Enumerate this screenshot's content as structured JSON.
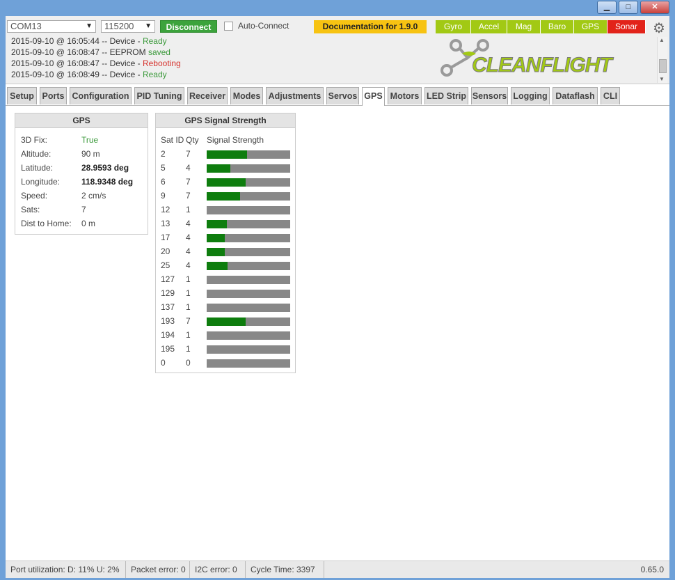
{
  "window": {
    "minimize": "▁",
    "maximize": "□",
    "close": "✕"
  },
  "connection": {
    "port": "COM13",
    "baud": "115200",
    "disconnect_label": "Disconnect",
    "auto_connect_label": "Auto-Connect"
  },
  "documentation_label": "Documentation for 1.9.0",
  "sensors": [
    {
      "label": "Gyro",
      "state": "on"
    },
    {
      "label": "Accel",
      "state": "on"
    },
    {
      "label": "Mag",
      "state": "on"
    },
    {
      "label": "Baro",
      "state": "on"
    },
    {
      "label": "GPS",
      "state": "on"
    },
    {
      "label": "Sonar",
      "state": "off"
    }
  ],
  "log": [
    {
      "prefix": "2015-09-10 @ 16:05:44 -- Device - ",
      "status": "Ready",
      "kind": "ok"
    },
    {
      "prefix": "2015-09-10 @ 16:08:47 -- EEPROM ",
      "status": "saved",
      "kind": "ok"
    },
    {
      "prefix": "2015-09-10 @ 16:08:47 -- Device - ",
      "status": "Rebooting",
      "kind": "warn"
    },
    {
      "prefix": "2015-09-10 @ 16:08:49 -- Device - ",
      "status": "Ready",
      "kind": "ok"
    }
  ],
  "logo_text": "CLEANFLIGHT",
  "tabs": [
    "Setup",
    "Ports",
    "Configuration",
    "PID Tuning",
    "Receiver",
    "Modes",
    "Adjustments",
    "Servos",
    "GPS",
    "Motors",
    "LED Strip",
    "Sensors",
    "Logging",
    "Dataflash",
    "CLI"
  ],
  "active_tab": "GPS",
  "gps_panel": {
    "title": "GPS",
    "rows": [
      {
        "label": "3D Fix:",
        "value": "True",
        "style": "green"
      },
      {
        "label": "Altitude:",
        "value": "90 m",
        "style": ""
      },
      {
        "label": "Latitude:",
        "value": "28.9593 deg",
        "style": "bold"
      },
      {
        "label": "Longitude:",
        "value": "118.9348 deg",
        "style": "bold"
      },
      {
        "label": "Speed:",
        "value": "2 cm/s",
        "style": ""
      },
      {
        "label": "Sats:",
        "value": "7",
        "style": ""
      },
      {
        "label": "Dist to Home:",
        "value": "0 m",
        "style": ""
      }
    ]
  },
  "signal_panel": {
    "title": "GPS Signal Strength",
    "headers": {
      "sat_id": "Sat ID",
      "qty": "Qty",
      "strength": "Signal Strength"
    },
    "sats": [
      {
        "id": "2",
        "qty": "7",
        "strength": 0.48
      },
      {
        "id": "5",
        "qty": "4",
        "strength": 0.28
      },
      {
        "id": "6",
        "qty": "7",
        "strength": 0.47
      },
      {
        "id": "9",
        "qty": "7",
        "strength": 0.4
      },
      {
        "id": "12",
        "qty": "1",
        "strength": 0
      },
      {
        "id": "13",
        "qty": "4",
        "strength": 0.24
      },
      {
        "id": "17",
        "qty": "4",
        "strength": 0.22
      },
      {
        "id": "20",
        "qty": "4",
        "strength": 0.22
      },
      {
        "id": "25",
        "qty": "4",
        "strength": 0.25
      },
      {
        "id": "127",
        "qty": "1",
        "strength": 0
      },
      {
        "id": "129",
        "qty": "1",
        "strength": 0
      },
      {
        "id": "137",
        "qty": "1",
        "strength": 0
      },
      {
        "id": "193",
        "qty": "7",
        "strength": 0.47
      },
      {
        "id": "194",
        "qty": "1",
        "strength": 0
      },
      {
        "id": "195",
        "qty": "1",
        "strength": 0
      },
      {
        "id": "0",
        "qty": "0",
        "strength": 0
      }
    ]
  },
  "status": {
    "port_util": "Port utilization: D: 11% U: 2%",
    "packet_error": "Packet error: 0",
    "i2c_error": "I2C error: 0",
    "cycle_time": "Cycle Time: 3397",
    "version": "0.65.0"
  },
  "colors": {
    "sensor_on": "#a2c914",
    "sensor_off": "#e2231a",
    "signal": "#0e7d0e",
    "accent": "#f7c312"
  }
}
